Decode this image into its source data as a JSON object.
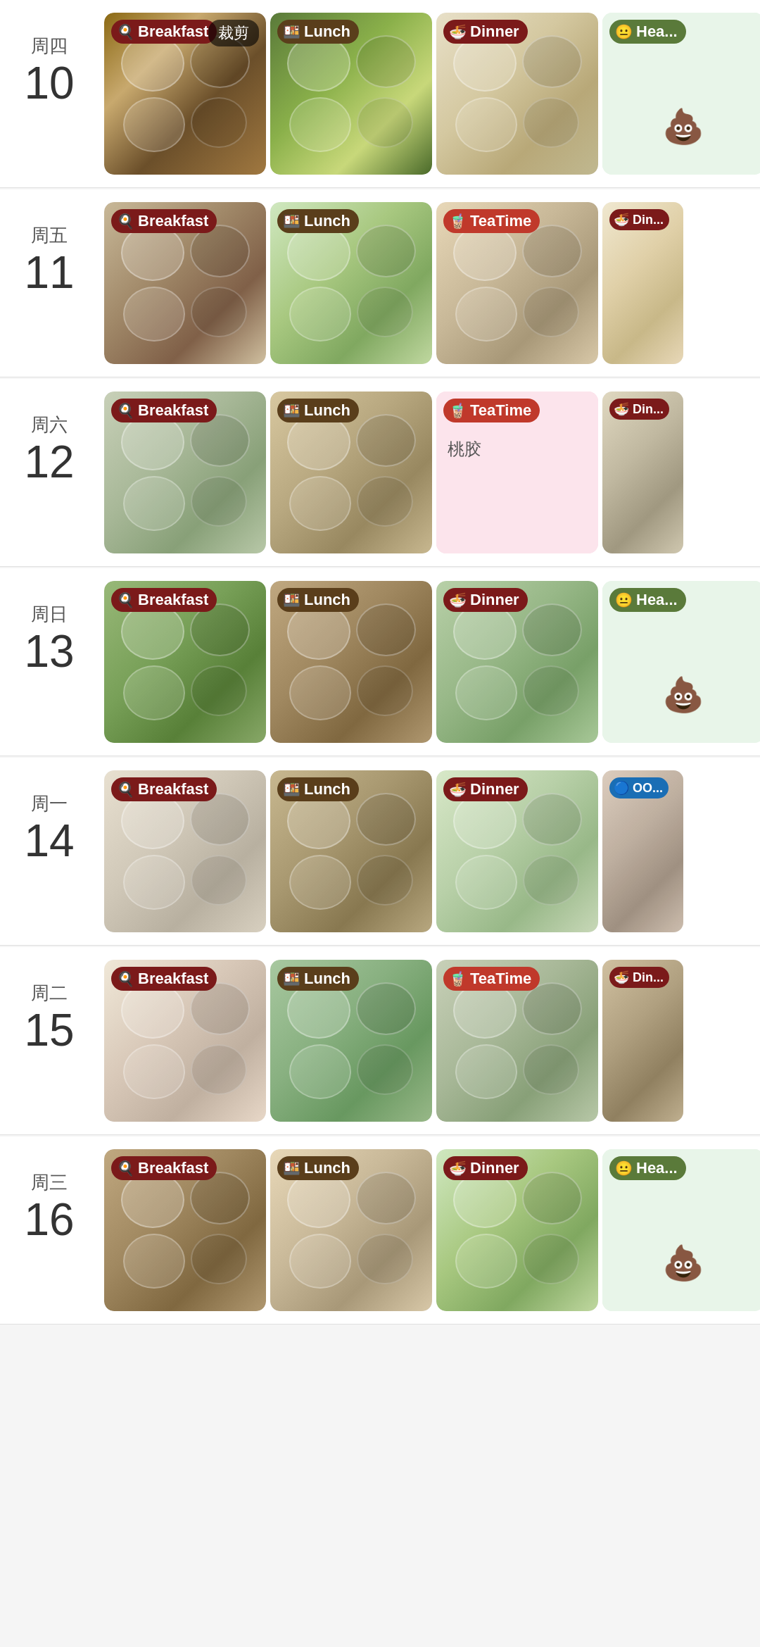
{
  "days": [
    {
      "week": "周四",
      "num": "10",
      "meals": [
        {
          "type": "breakfast",
          "label": "Breakfast",
          "icon": "🍳",
          "bg": "bg-1",
          "hasCrop": true
        },
        {
          "type": "lunch",
          "label": "Lunch",
          "icon": "🍱",
          "bg": "bg-2",
          "hasCrop": false
        },
        {
          "type": "dinner",
          "label": "Dinner",
          "icon": "🍜",
          "bg": "bg-3",
          "hasCrop": false
        },
        {
          "type": "health",
          "label": "Hea...",
          "icon": "😐",
          "bg": "bg-4",
          "hasCrop": false,
          "isHealth": true
        }
      ]
    },
    {
      "week": "周五",
      "num": "11",
      "meals": [
        {
          "type": "breakfast",
          "label": "Breakfast",
          "icon": "🍳",
          "bg": "bg-5"
        },
        {
          "type": "lunch",
          "label": "Lunch",
          "icon": "🍱",
          "bg": "bg-6"
        },
        {
          "type": "teatime",
          "label": "TeaTime",
          "icon": "🧋",
          "bg": "bg-7"
        },
        {
          "type": "dinner",
          "label": "Din...",
          "icon": "🍜",
          "bg": "bg-8",
          "isPartial": true
        }
      ]
    },
    {
      "week": "周六",
      "num": "12",
      "meals": [
        {
          "type": "breakfast",
          "label": "Breakfast",
          "icon": "🍳",
          "bg": "bg-9"
        },
        {
          "type": "lunch",
          "label": "Lunch",
          "icon": "🍱",
          "bg": "bg-10"
        },
        {
          "type": "teatime",
          "label": "TeaTime",
          "icon": "🧋",
          "isTextCard": true,
          "text": "桃胶"
        },
        {
          "type": "dinner",
          "label": "Din...",
          "icon": "🍜",
          "bg": "bg-11",
          "isPartial": true
        }
      ]
    },
    {
      "week": "周日",
      "num": "13",
      "meals": [
        {
          "type": "breakfast",
          "label": "Breakfast",
          "icon": "🍳",
          "bg": "bg-12"
        },
        {
          "type": "lunch",
          "label": "Lunch",
          "icon": "🍱",
          "bg": "bg-13"
        },
        {
          "type": "dinner",
          "label": "Dinner",
          "icon": "🍜",
          "bg": "bg-14"
        },
        {
          "type": "health",
          "label": "Hea...",
          "icon": "😐",
          "bg": "bg-4",
          "isHealth": true
        }
      ]
    },
    {
      "week": "周一",
      "num": "14",
      "meals": [
        {
          "type": "breakfast",
          "label": "Breakfast",
          "icon": "🍳",
          "bg": "bg-15"
        },
        {
          "type": "lunch",
          "label": "Lunch",
          "icon": "🍱",
          "bg": "bg-16"
        },
        {
          "type": "dinner",
          "label": "Dinner",
          "icon": "🍜",
          "bg": "bg-17"
        },
        {
          "type": "other",
          "label": "OO...",
          "icon": "🔵",
          "bg": "bg-18",
          "isPartial": true
        }
      ]
    },
    {
      "week": "周二",
      "num": "15",
      "meals": [
        {
          "type": "breakfast",
          "label": "Breakfast",
          "icon": "🍳",
          "bg": "bg-19"
        },
        {
          "type": "lunch",
          "label": "Lunch",
          "icon": "🍱",
          "bg": "bg-20"
        },
        {
          "type": "teatime",
          "label": "TeaTime",
          "icon": "🧋",
          "bg": "bg-9"
        },
        {
          "type": "dinner",
          "label": "Din...",
          "icon": "🍜",
          "bg": "bg-21",
          "isPartial": true
        }
      ]
    },
    {
      "week": "周三",
      "num": "16",
      "meals": [
        {
          "type": "breakfast",
          "label": "Breakfast",
          "icon": "🍳",
          "bg": "bg-13"
        },
        {
          "type": "lunch",
          "label": "Lunch",
          "icon": "🍱",
          "bg": "bg-7"
        },
        {
          "type": "dinner",
          "label": "Dinner",
          "icon": "🍜",
          "bg": "bg-6"
        },
        {
          "type": "health",
          "label": "Hea...",
          "icon": "😐",
          "bg": "bg-4",
          "isHealth": true
        }
      ]
    }
  ],
  "labels": {
    "crop": "裁剪",
    "peach_gum": "桃胶"
  }
}
